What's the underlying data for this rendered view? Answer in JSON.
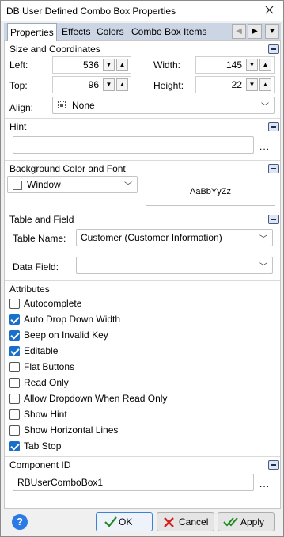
{
  "window": {
    "title": "DB User Defined Combo Box Properties"
  },
  "tabs": [
    "Properties",
    "Effects",
    "Colors",
    "Combo Box Items"
  ],
  "size_coords": {
    "title": "Size and Coordinates",
    "left_label": "Left:",
    "left_value": "536",
    "top_label": "Top:",
    "top_value": "96",
    "width_label": "Width:",
    "width_value": "145",
    "height_label": "Height:",
    "height_value": "22",
    "align_label": "Align:",
    "align_value": "None"
  },
  "hint": {
    "title": "Hint",
    "value": "",
    "ellipsis": "..."
  },
  "bg_font": {
    "title": "Background Color and Font",
    "color_value": "Window",
    "font_preview": "AaBbYyZz"
  },
  "table_field": {
    "title": "Table and Field",
    "table_label": "Table Name:",
    "table_value": "Customer  (Customer Information)",
    "field_label": "Data Field:",
    "field_value": ""
  },
  "attributes": {
    "title": "Attributes",
    "items": [
      {
        "label": "Autocomplete",
        "checked": false
      },
      {
        "label": "Auto Drop Down Width",
        "checked": true
      },
      {
        "label": "Beep on Invalid Key",
        "checked": true
      },
      {
        "label": "Editable",
        "checked": true
      },
      {
        "label": "Flat Buttons",
        "checked": false
      },
      {
        "label": "Read Only",
        "checked": false
      },
      {
        "label": "Allow Dropdown When Read Only",
        "checked": false
      },
      {
        "label": "Show Hint",
        "checked": false
      },
      {
        "label": "Show Horizontal Lines",
        "checked": false
      },
      {
        "label": "Tab Stop",
        "checked": true
      }
    ]
  },
  "component_id": {
    "title": "Component ID",
    "value": "RBUserComboBox1",
    "ellipsis": "..."
  },
  "footer": {
    "ok_label": "OK",
    "cancel_label": "Cancel",
    "apply_label": "Apply",
    "help": "?"
  },
  "colors": {
    "accent": "#1a6fc9",
    "tabbar": "#ccd5e3",
    "ok_icon": "#1f8a1f",
    "cancel_icon": "#d42020"
  }
}
